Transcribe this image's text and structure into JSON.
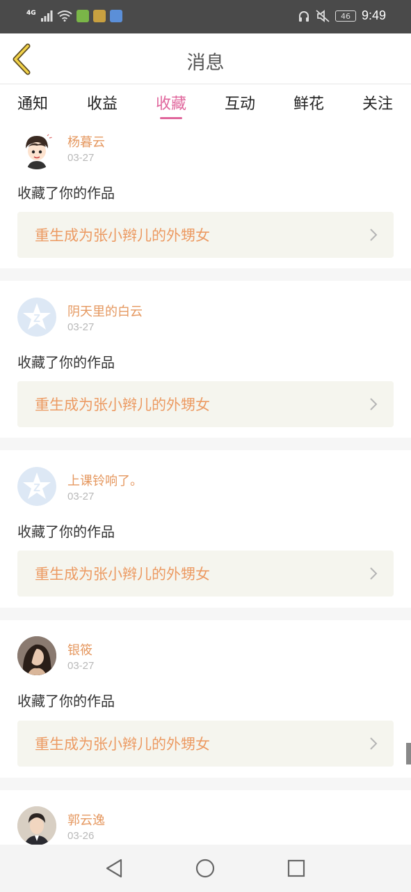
{
  "status_bar": {
    "network": "4G",
    "battery": "46",
    "time": "9:49"
  },
  "header": {
    "title": "消息",
    "back_icon": "chevron-left-icon"
  },
  "tabs": [
    {
      "label": "通知",
      "active": false
    },
    {
      "label": "收益",
      "active": false
    },
    {
      "label": "收藏",
      "active": true
    },
    {
      "label": "互动",
      "active": false
    },
    {
      "label": "鲜花",
      "active": false
    },
    {
      "label": "关注",
      "active": false
    }
  ],
  "colors": {
    "accent": "#e0669c",
    "username": "#e59860",
    "work_title": "#ec9a62",
    "work_box_bg": "#f5f5ee"
  },
  "messages": [
    {
      "username": "杨暮云",
      "date": "03-27",
      "action": "收藏了你的作品",
      "work_title": "重生成为张小辫儿的外甥女",
      "avatar": "cartoon-avatar"
    },
    {
      "username": "阴天里的白云",
      "date": "03-27",
      "action": "收藏了你的作品",
      "work_title": "重生成为张小辫儿的外甥女",
      "avatar": "default-avatar"
    },
    {
      "username": "上课铃响了。",
      "date": "03-27",
      "action": "收藏了你的作品",
      "work_title": "重生成为张小辫儿的外甥女",
      "avatar": "default-avatar"
    },
    {
      "username": "银筱",
      "date": "03-27",
      "action": "收藏了你的作品",
      "work_title": "重生成为张小辫儿的外甥女",
      "avatar": "photo-avatar"
    },
    {
      "username": "郭云逸",
      "date": "03-26",
      "action": "",
      "work_title": "",
      "avatar": "photo-avatar"
    }
  ],
  "nav_bar": {
    "back_icon": "triangle-back-icon",
    "home_icon": "circle-home-icon",
    "recents_icon": "square-recents-icon"
  }
}
